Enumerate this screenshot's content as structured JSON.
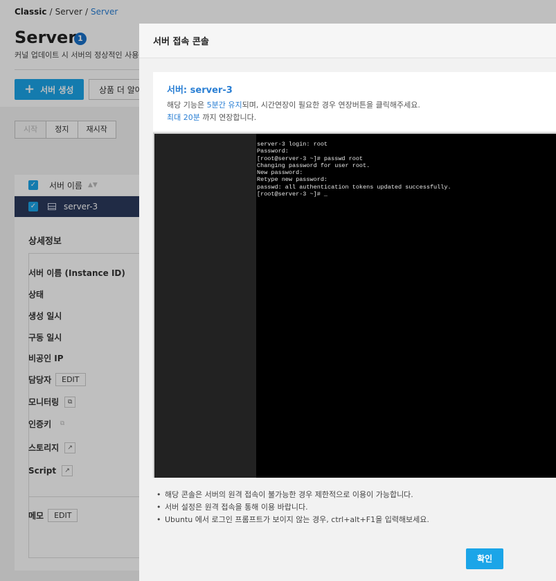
{
  "breadcrumb": [
    "Classic",
    "/",
    "Server",
    "/",
    "Server"
  ],
  "page": {
    "title": "Server",
    "badge": "1",
    "description": "커널 업데이트 시 서버의 정상적인 사용을",
    "create_button": "서버 생성",
    "more_button": "상품 더 알아보기"
  },
  "actions": [
    "시작",
    "정지",
    "재시작"
  ],
  "list": {
    "header": "서버 이름",
    "row": "server-3"
  },
  "detail": {
    "title": "상세정보",
    "rows": [
      "서버 이름 (Instance ID)",
      "상태",
      "생성 일시",
      "구동 일시",
      "비공인 IP",
      "담당자",
      "모니터링",
      "인증키",
      "스토리지",
      "Script",
      "메모"
    ],
    "edit_label": "EDIT"
  },
  "modal": {
    "title": "서버 접속 콘솔",
    "server_label": "서버: server-3",
    "line1_pre": "해당 기능은 ",
    "line1_hl": "5분간 유지",
    "line1_post": "되며, 시간연장이 필요한 경우 연장버튼을 클릭해주세요.",
    "line2_hl": "최대 20분",
    "line2_post": " 까지 연장합니다.",
    "console_lines": [
      "server-3 login: root",
      "Password:",
      "[root@server-3 ~]# passwd root",
      "Changing password for user root.",
      "New password:",
      "Retype new password:",
      "passwd: all authentication tokens updated successfully.",
      "[root@server-3 ~]# _"
    ],
    "notes": [
      "해당 콘솔은 서버의 원격 접속이 불가능한 경우 제한적으로 이용이 가능합니다.",
      "서버 설정은 원격 접속을 통해 이용 바랍니다.",
      "Ubuntu 에서 로그인 프롬프트가 보이지 않는 경우, ctrl+alt+F1을 입력해보세요."
    ],
    "confirm": "확인"
  }
}
